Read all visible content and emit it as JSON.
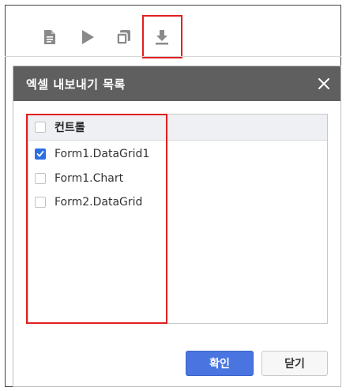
{
  "toolbar": {
    "icons": [
      "document-icon",
      "play-icon",
      "copy-icon",
      "download-icon"
    ]
  },
  "dialog": {
    "title": "엑셀 내보내기 목록",
    "close_icon": "close-icon",
    "list": {
      "header": {
        "label": "컨트롤",
        "checked": false
      },
      "items": [
        {
          "label": "Form1.DataGrid1",
          "checked": true
        },
        {
          "label": "Form1.Chart",
          "checked": false
        },
        {
          "label": "Form2.DataGrid",
          "checked": false
        }
      ]
    },
    "buttons": {
      "ok_label": "확인",
      "close_label": "닫기"
    }
  },
  "colors": {
    "header_bg": "#5f5f5f",
    "accent": "#4a74e0",
    "checkbox_checked": "#2b6fe3",
    "highlight": "#e02020"
  }
}
